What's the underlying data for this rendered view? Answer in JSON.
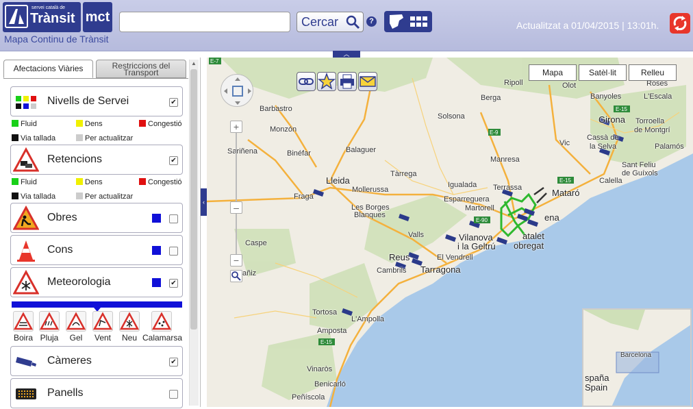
{
  "header": {
    "logo_small": "servei català de",
    "logo_big": "Trànsit",
    "logo_mct": "mct",
    "subtitle": "Mapa Continu de Trànsit",
    "search_value": "",
    "search_label": "Cercar",
    "help": "?",
    "updated": "Actualitzat a 01/04/2015 | 13:01h."
  },
  "sidebar": {
    "tabs": [
      "Afectacions Viàries",
      "Restriccions del Transport"
    ],
    "layers": [
      {
        "label": "Nivells de Servei",
        "checked": "✔"
      },
      {
        "label": "Retencions",
        "checked": "✔"
      },
      {
        "label": "Obres",
        "checked": ""
      },
      {
        "label": "Cons",
        "checked": ""
      },
      {
        "label": "Meteorologia",
        "checked": "✔"
      },
      {
        "label": "Càmeres",
        "checked": "✔"
      },
      {
        "label": "Panells",
        "checked": ""
      }
    ],
    "legend": [
      "Fluid",
      "Dens",
      "Congestió",
      "Via tallada",
      "Per actualitzar"
    ],
    "meteo": [
      "Boira",
      "Pluja",
      "Gel",
      "Vent",
      "Neu",
      "Calamarsa"
    ]
  },
  "map": {
    "types": [
      "Mapa",
      "Satèl·lit",
      "Relleu"
    ],
    "places": {
      "ripoll": "Ripoll",
      "olot": "Olot",
      "roses": "Roses",
      "banyoles": "Banyoles",
      "lescala": "L'Escala",
      "girona": "Girona",
      "torroella": "Torroella",
      "montgri": "de Montgrí",
      "cassa": "Cassà de",
      "laselva": "la Selva",
      "palamos": "Palamós",
      "santfeliu": "Sant Feliu",
      "guixols": "de Guíxols",
      "barbastro": "Barbastro",
      "berga": "Berga",
      "solsona": "Solsona",
      "monzon": "Monzón",
      "binefar": "Binéfar",
      "balaguer": "Balaguer",
      "manresa": "Manresa",
      "vic": "Vic",
      "sarinena": "Sariñena",
      "tarrega": "Tàrrega",
      "lleida": "Lleida",
      "mollerussa": "Mollerussa",
      "igualada": "Igualada",
      "terrassa": "Terrassa",
      "mataro": "Mataró",
      "calella": "Calella",
      "fraga": "Fraga",
      "lesborges": "Les Borges",
      "blanques": "Blanques",
      "esparreguera": "Esparreguera",
      "martorell": "Martorell",
      "valls": "Valls",
      "caspe": "Caspe",
      "vilanova": "Vilanova",
      "geltru": "i la Geltrú",
      "obregat": "obregat",
      "ena": "ena",
      "atalet": "atalet",
      "reus": "Reus",
      "elvendrell": "El Vendrell",
      "cambrils": "Cambrils",
      "tarragona": "Tarragona",
      "alcaniz": "añiz",
      "tortosa": "Tortosa",
      "lampolla": "L'Ampolla",
      "amposta": "Amposta",
      "vinaros": "Vinaròs",
      "benicarlo": "Benicarló",
      "peniscola": "Peñíscola",
      "barcelona": "Barcelona",
      "espana": "spaña",
      "spain": "Spain"
    },
    "roads": {
      "e7": "E-7",
      "e9": "E-9",
      "e15a": "E-15",
      "e15b": "E-15",
      "e15c": "E-15",
      "e90": "E-90"
    }
  }
}
